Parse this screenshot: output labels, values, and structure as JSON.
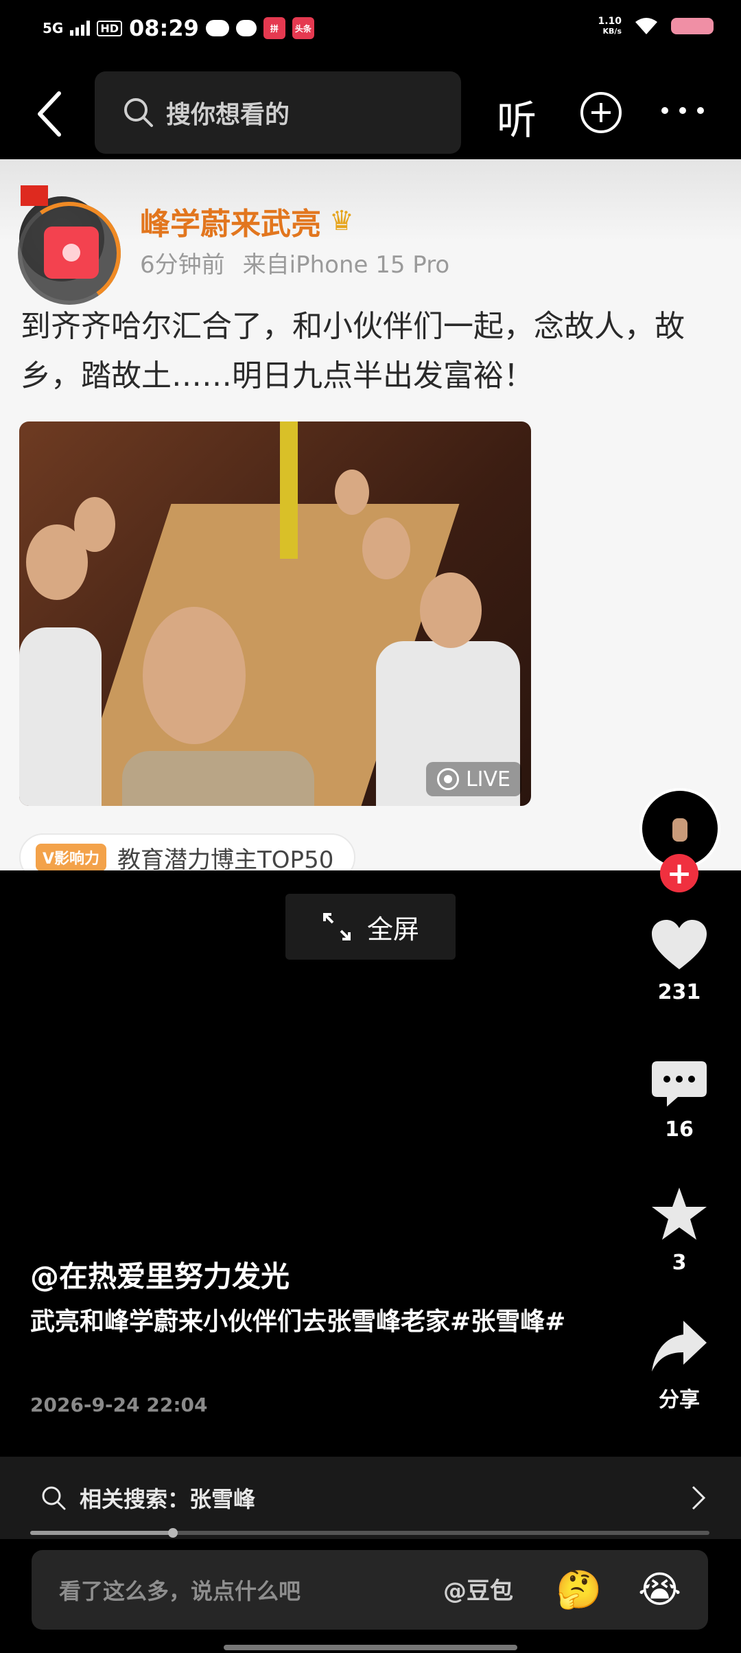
{
  "status_bar": {
    "network": "5G",
    "hd": "HD",
    "time": "08:29",
    "speed_value": "1.10",
    "speed_unit": "KB/s",
    "app_badge_1": "拼",
    "app_badge_2": "头条"
  },
  "nav": {
    "search_placeholder": "搜你想看的",
    "listen_label": "听"
  },
  "post": {
    "author": "峰学蔚来武亮",
    "time_ago": "6分钟前",
    "source": "来自iPhone 15 Pro",
    "text": "到齐齐哈尔汇合了，和小伙伴们一起，念故人，故乡，踏故土……明日九点半出发富裕！",
    "live_label": "LIVE",
    "badge_tag": "V影响力",
    "badge_text": "教育潜力博主TOP50"
  },
  "fullscreen_label": "全屏",
  "actions": {
    "likes": "231",
    "comments": "16",
    "favorites": "3",
    "share_label": "分享"
  },
  "video": {
    "username": "@在热爱里努力发光",
    "caption": "武亮和峰学蔚来小伙伴们去张雪峰老家#张雪峰#",
    "date": "2026-9-24 22:04",
    "progress": 0.21
  },
  "related_search": {
    "label": "相关搜索：张雪峰"
  },
  "comment_bar": {
    "placeholder": "看了这么多，说点什么吧",
    "mention": "@豆包",
    "emoji_1": "🤔",
    "emoji_2": "😭"
  },
  "colors": {
    "author": "#e2761e",
    "follow": "#f0303f",
    "badge_tag": "#f3a24a"
  }
}
